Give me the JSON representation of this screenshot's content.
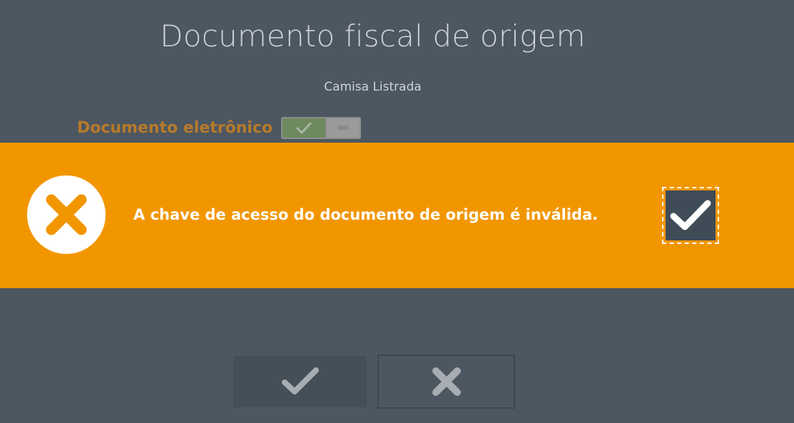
{
  "dialog": {
    "title": "Documento fiscal de origem",
    "product_name": "Camisa Listrada",
    "electronic_doc_label": "Documento eletrônico",
    "electronic_doc_toggle": "on"
  },
  "alert": {
    "message": "A chave de acesso do documento de origem é inválida.",
    "icon": "close-circle-icon",
    "confirm_icon": "checkmark-icon",
    "background_color": "#f29600"
  },
  "footer": {
    "ok_icon": "checkmark-icon",
    "cancel_icon": "close-icon"
  },
  "colors": {
    "background": "#4c5761",
    "label_accent": "#b77a2b",
    "alert": "#f29600"
  }
}
